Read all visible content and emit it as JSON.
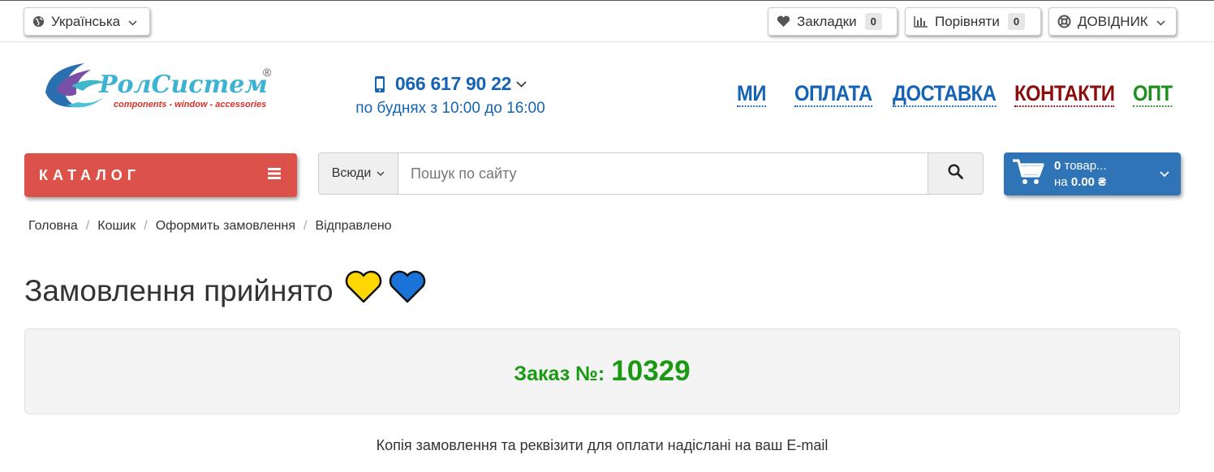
{
  "topbar": {
    "language": "Українська",
    "bookmarks": {
      "label": "Закладки",
      "count": "0"
    },
    "compare": {
      "label": "Порівняти",
      "count": "0"
    },
    "help": "ДОВІДНИК"
  },
  "logo": {
    "brand": "РолСистем",
    "tagline": "components - window - accessories",
    "registered": "®"
  },
  "contact": {
    "phone": "066 617 90 22",
    "hours": "по буднях з 10:00 до 16:00"
  },
  "nav": [
    {
      "label": "МИ",
      "color": "#1463b4"
    },
    {
      "label": "ОПЛАТА",
      "color": "#1463b4"
    },
    {
      "label": "ДОСТАВКА",
      "color": "#1463b4"
    },
    {
      "label": "КОНТАКТИ",
      "color": "#8b0d0d"
    },
    {
      "label": "ОПТ",
      "color": "#1d8f1d"
    }
  ],
  "catalog": {
    "label": "КАТАЛОГ"
  },
  "search": {
    "scope": "Всюди",
    "placeholder": "Пошук по сайту"
  },
  "cart": {
    "count": "0",
    "items_label": "товар...",
    "total_prefix": "на",
    "total": "0.00 ₴"
  },
  "breadcrumb": [
    "Головна",
    "Кошик",
    "Оформить замовлення",
    "Відправлено"
  ],
  "page": {
    "title": "Замовлення прийнято",
    "order_label": "Заказ №:",
    "order_number": "10329",
    "note": "Копія замовлення та реквізити для оплати надіслані на ваш E-mail"
  },
  "colors": {
    "catalog": "#dc5149",
    "cart": "#2f74b7",
    "order_text": "#1a9a12",
    "heart_yellow": "#ffd700",
    "heart_blue": "#1a73d9"
  }
}
